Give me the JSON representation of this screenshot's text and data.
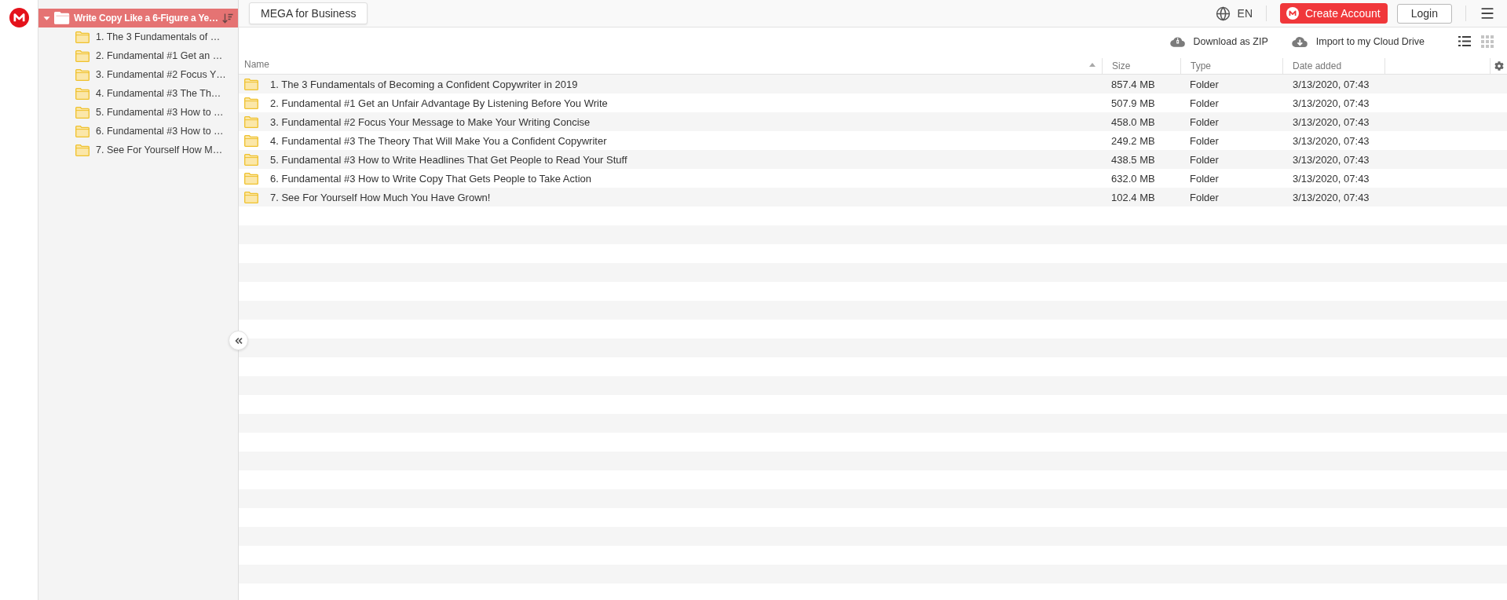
{
  "sidebar": {
    "tree": {
      "label": "Write Copy Like a 6-Figure a Ye…",
      "expanded": true,
      "selected": true,
      "children": [
        {
          "label": "1. The 3 Fundamentals of …",
          "selected": false
        },
        {
          "label": "2. Fundamental #1 Get an …",
          "selected": false
        },
        {
          "label": "3. Fundamental #2 Focus Y…",
          "selected": false
        },
        {
          "label": "4. Fundamental #3 The Th…",
          "selected": false
        },
        {
          "label": "5. Fundamental #3 How to …",
          "selected": false
        },
        {
          "label": "6. Fundamental #3 How to …",
          "selected": false
        },
        {
          "label": "7. See For Yourself How M…",
          "selected": false
        }
      ]
    }
  },
  "top_bar": {
    "business_link": "MEGA for Business",
    "language": "EN",
    "create_account": "Create Account",
    "login": "Login"
  },
  "toolbar": {
    "actions": [
      {
        "kind": "download_zip",
        "label": "Download as ZIP"
      },
      {
        "kind": "import",
        "label": "Import to my Cloud Drive"
      }
    ],
    "view_modes": [
      {
        "kind": "list",
        "selected": true
      },
      {
        "kind": "grid",
        "selected": false
      }
    ]
  },
  "table": {
    "columns": [
      {
        "label": "Name",
        "sorted": true
      },
      {
        "label": "Size",
        "sorted": false
      },
      {
        "label": "Type",
        "sorted": false
      },
      {
        "label": "Date added",
        "sorted": false
      }
    ],
    "rows": [
      {
        "name": "1. The 3 Fundamentals of Becoming a Confident Copywriter in 2019",
        "size": "857.4 MB",
        "type": "Folder",
        "date_added": "3/13/2020, 07:43"
      },
      {
        "name": "2. Fundamental #1 Get an Unfair Advantage By Listening Before You Write",
        "size": "507.9 MB",
        "type": "Folder",
        "date_added": "3/13/2020, 07:43"
      },
      {
        "name": "3. Fundamental #2 Focus Your Message to Make Your Writing Concise",
        "size": "458.0 MB",
        "type": "Folder",
        "date_added": "3/13/2020, 07:43"
      },
      {
        "name": "4. Fundamental #3 The Theory That Will Make You a Confident Copywriter",
        "size": "249.2 MB",
        "type": "Folder",
        "date_added": "3/13/2020, 07:43"
      },
      {
        "name": "5. Fundamental #3 How to Write Headlines That Get People to Read Your Stuff",
        "size": "438.5 MB",
        "type": "Folder",
        "date_added": "3/13/2020, 07:43"
      },
      {
        "name": "6. Fundamental #3 How to Write Copy That Gets People to Take Action",
        "size": "632.0 MB",
        "type": "Folder",
        "date_added": "3/13/2020, 07:43"
      },
      {
        "name": "7. See For Yourself How Much You Have Grown!",
        "size": "102.4 MB",
        "type": "Folder",
        "date_added": "3/13/2020, 07:43"
      }
    ]
  }
}
